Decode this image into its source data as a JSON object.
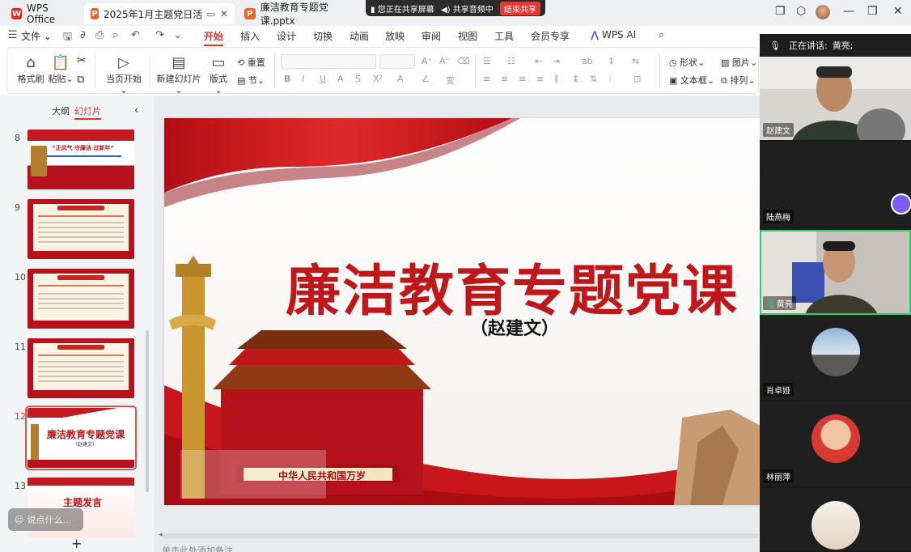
{
  "titlebar": {
    "home_tab": "WPS Office",
    "tabs": [
      {
        "label": "2025年1月主题党日活动会标..."
      },
      {
        "label": "廉洁教育专题党课.pptx"
      }
    ]
  },
  "share_bar": {
    "status": "您正在共享屏幕",
    "audio": "共享音频中",
    "end_button": "结束共享"
  },
  "menu": {
    "file": "文件",
    "tabs": [
      "开始",
      "插入",
      "设计",
      "切换",
      "动画",
      "放映",
      "审阅",
      "视图",
      "工具",
      "会员专享"
    ],
    "active_tab": "开始",
    "ai": "WPS AI"
  },
  "ribbon": {
    "format_painter": "格式刷",
    "paste": "粘贴",
    "play_from_current": "当页开始",
    "new_slide": "新建幻灯片",
    "layout": "版式",
    "section": "节",
    "reset": "重置",
    "shape": "形状",
    "picture": "图片",
    "textbox": "文本框",
    "arrange": "排列"
  },
  "left_panel": {
    "tab_outline": "大纲",
    "tab_slides": "幻灯片",
    "slides": [
      {
        "num": "8"
      },
      {
        "num": "9"
      },
      {
        "num": "10"
      },
      {
        "num": "11"
      },
      {
        "num": "12",
        "thumb_title": "廉洁教育专题党课",
        "thumb_sub": "（赵建文）"
      },
      {
        "num": "13",
        "thumb_title": "主题发言"
      }
    ],
    "thumb8_title": "“正风气 守廉洁 过新年”",
    "comment_placeholder": "说点什么..."
  },
  "slide": {
    "title": "廉洁教育专题党课",
    "subtitle": "（赵建文）",
    "gate_banner": "中华人民共和国万岁"
  },
  "notes_placeholder": "单击此处添加备注",
  "meeting": {
    "speaking_label": "正在讲话:",
    "speaking_name": "黄亮;",
    "participants": [
      {
        "name": "赵建文"
      },
      {
        "name": "陆燕梅"
      },
      {
        "name": "黄亮"
      },
      {
        "name": "肖卓娅"
      },
      {
        "name": "林丽萍"
      }
    ]
  },
  "colors": {
    "accent": "#d83a2f",
    "title_red": "#c0171b",
    "active_speaker": "#2ecc71"
  }
}
